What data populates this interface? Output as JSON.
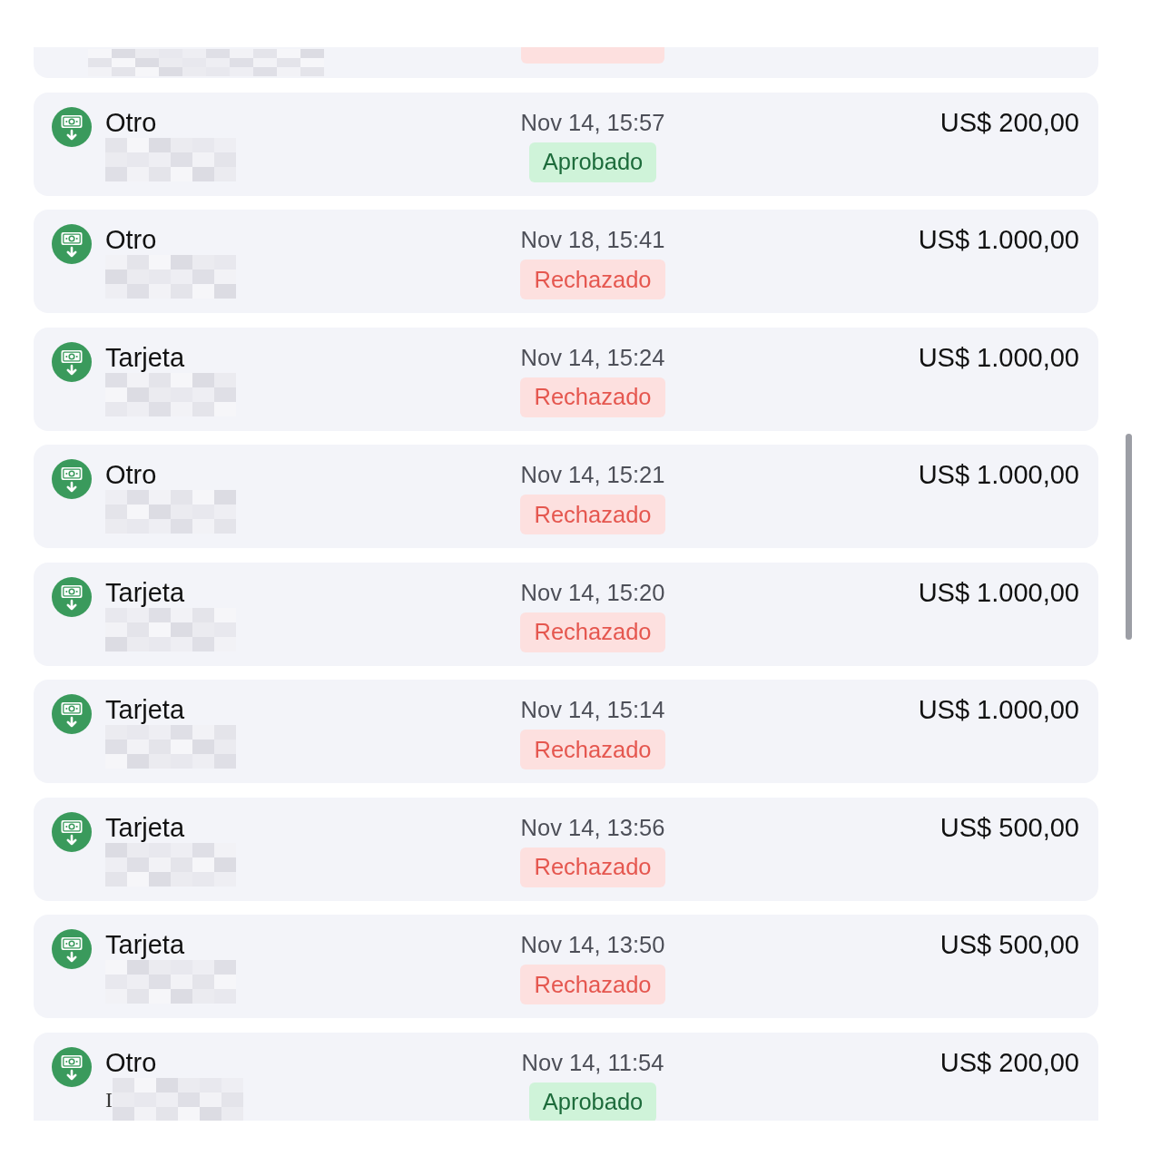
{
  "cut_off_item": {
    "approved": false,
    "redacted": true
  },
  "transactions": [
    {
      "method": "Otro",
      "redacted": true,
      "date": "Nov 14, 15:57",
      "status": "Aprobado",
      "approved": true,
      "amount": "US$ 200,00"
    },
    {
      "method": "Otro",
      "redacted": true,
      "date": "Nov 18, 15:41",
      "status": "Rechazado",
      "approved": false,
      "amount": "US$ 1.000,00"
    },
    {
      "method": "Tarjeta",
      "redacted": true,
      "date": "Nov 14, 15:24",
      "status": "Rechazado",
      "approved": false,
      "amount": "US$ 1.000,00"
    },
    {
      "method": "Otro",
      "redacted": true,
      "date": "Nov 14, 15:21",
      "status": "Rechazado",
      "approved": false,
      "amount": "US$ 1.000,00"
    },
    {
      "method": "Tarjeta",
      "redacted": true,
      "date": "Nov 14, 15:20",
      "status": "Rechazado",
      "approved": false,
      "amount": "US$ 1.000,00"
    },
    {
      "method": "Tarjeta",
      "redacted": true,
      "date": "Nov 14, 15:14",
      "status": "Rechazado",
      "approved": false,
      "amount": "US$ 1.000,00"
    },
    {
      "method": "Tarjeta",
      "redacted": true,
      "date": "Nov 14, 13:56",
      "status": "Rechazado",
      "approved": false,
      "amount": "US$ 500,00"
    },
    {
      "method": "Tarjeta",
      "redacted": true,
      "date": "Nov 14, 13:50",
      "status": "Rechazado",
      "approved": false,
      "amount": "US$ 500,00"
    },
    {
      "method": "Otro",
      "detail": "I",
      "redacted": true,
      "date": "Nov 14, 11:54",
      "status": "Aprobado",
      "approved": true,
      "amount": "US$ 200,00"
    }
  ]
}
